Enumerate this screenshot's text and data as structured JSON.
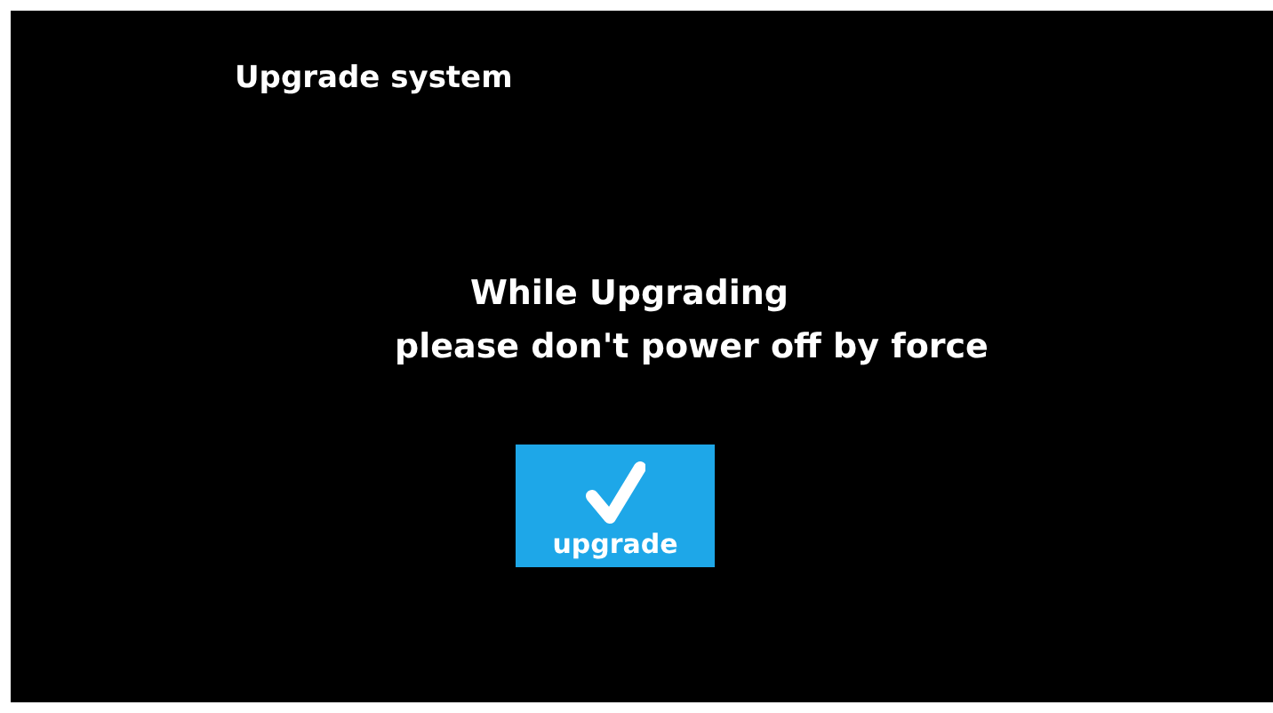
{
  "screen": {
    "title": "Upgrade system"
  },
  "message": [
    "While Upgrading",
    "please don't power off by force"
  ],
  "button": {
    "label": "upgrade"
  }
}
